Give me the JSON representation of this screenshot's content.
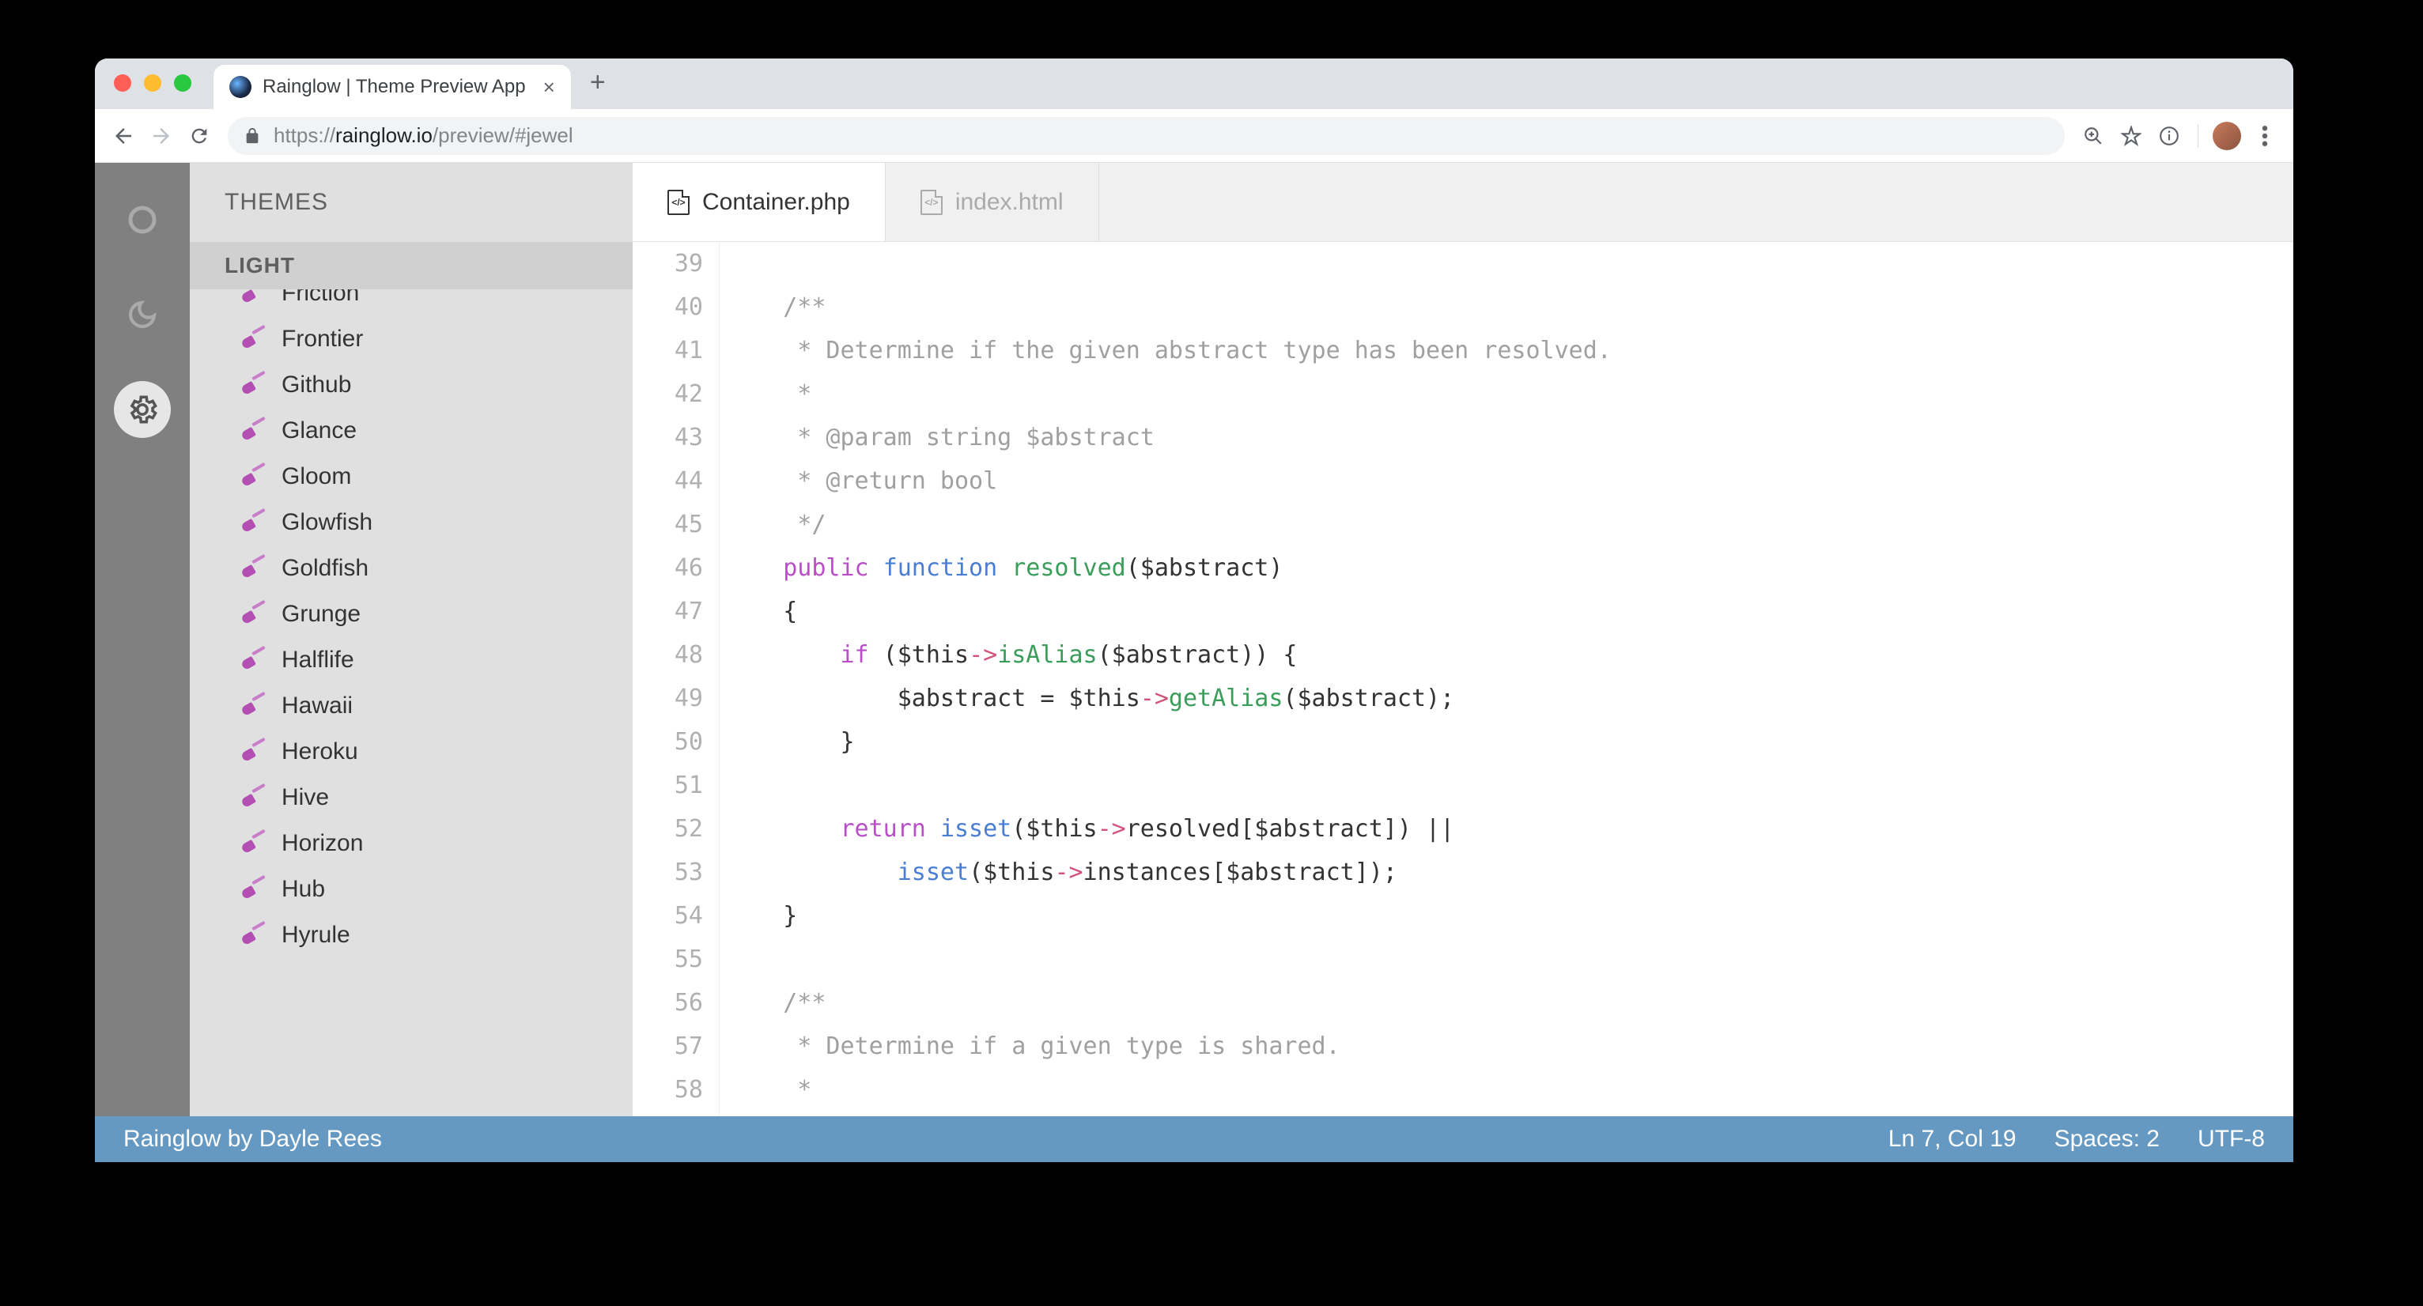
{
  "browser": {
    "tab_title": "Rainglow | Theme Preview App",
    "url_scheme": "https://",
    "url_host": "rainglow.io",
    "url_path": "/preview/#jewel"
  },
  "rail": {
    "mode_light": "light",
    "mode_dark": "dark",
    "mode_settings": "settings"
  },
  "sidebar": {
    "header": "THEMES",
    "section": "LIGHT",
    "items": [
      "Friction",
      "Frontier",
      "Github",
      "Glance",
      "Gloom",
      "Glowfish",
      "Goldfish",
      "Grunge",
      "Halflife",
      "Hawaii",
      "Heroku",
      "Hive",
      "Horizon",
      "Hub",
      "Hyrule"
    ]
  },
  "editor_tabs": [
    {
      "name": "Container.php",
      "active": true
    },
    {
      "name": "index.html",
      "active": false
    }
  ],
  "line_start": 39,
  "code": [
    {
      "n": 39,
      "t": []
    },
    {
      "n": 40,
      "t": [
        {
          "c": "c-comm",
          "s": "    /**"
        }
      ]
    },
    {
      "n": 41,
      "t": [
        {
          "c": "c-comm",
          "s": "     * Determine if the given abstract type has been resolved."
        }
      ]
    },
    {
      "n": 42,
      "t": [
        {
          "c": "c-comm",
          "s": "     *"
        }
      ]
    },
    {
      "n": 43,
      "t": [
        {
          "c": "c-comm",
          "s": "     * @param string $abstract"
        }
      ]
    },
    {
      "n": 44,
      "t": [
        {
          "c": "c-comm",
          "s": "     * @return bool"
        }
      ]
    },
    {
      "n": 45,
      "t": [
        {
          "c": "c-comm",
          "s": "     */"
        }
      ]
    },
    {
      "n": 46,
      "t": [
        {
          "c": "",
          "s": "    "
        },
        {
          "c": "c-kw",
          "s": "public"
        },
        {
          "c": "",
          "s": " "
        },
        {
          "c": "c-kw2",
          "s": "function"
        },
        {
          "c": "",
          "s": " "
        },
        {
          "c": "c-fn",
          "s": "resolved"
        },
        {
          "c": "",
          "s": "($abstract)"
        }
      ]
    },
    {
      "n": 47,
      "t": [
        {
          "c": "",
          "s": "    {"
        }
      ]
    },
    {
      "n": 48,
      "t": [
        {
          "c": "",
          "s": "        "
        },
        {
          "c": "c-kw",
          "s": "if"
        },
        {
          "c": "",
          "s": " ($this"
        },
        {
          "c": "c-op",
          "s": "->"
        },
        {
          "c": "c-fn",
          "s": "isAlias"
        },
        {
          "c": "",
          "s": "($abstract)) {"
        }
      ]
    },
    {
      "n": 49,
      "t": [
        {
          "c": "",
          "s": "            $abstract = $this"
        },
        {
          "c": "c-op",
          "s": "->"
        },
        {
          "c": "c-fn",
          "s": "getAlias"
        },
        {
          "c": "",
          "s": "($abstract);"
        }
      ]
    },
    {
      "n": 50,
      "t": [
        {
          "c": "",
          "s": "        }"
        }
      ]
    },
    {
      "n": 51,
      "t": []
    },
    {
      "n": 52,
      "t": [
        {
          "c": "",
          "s": "        "
        },
        {
          "c": "c-kw",
          "s": "return"
        },
        {
          "c": "",
          "s": " "
        },
        {
          "c": "c-new",
          "s": "isset"
        },
        {
          "c": "",
          "s": "($this"
        },
        {
          "c": "c-op",
          "s": "->"
        },
        {
          "c": "",
          "s": "resolved[$abstract]) ||"
        }
      ]
    },
    {
      "n": 53,
      "t": [
        {
          "c": "",
          "s": "            "
        },
        {
          "c": "c-new",
          "s": "isset"
        },
        {
          "c": "",
          "s": "($this"
        },
        {
          "c": "c-op",
          "s": "->"
        },
        {
          "c": "",
          "s": "instances[$abstract]);"
        }
      ]
    },
    {
      "n": 54,
      "t": [
        {
          "c": "",
          "s": "    }"
        }
      ]
    },
    {
      "n": 55,
      "t": []
    },
    {
      "n": 56,
      "t": [
        {
          "c": "c-comm",
          "s": "    /**"
        }
      ]
    },
    {
      "n": 57,
      "t": [
        {
          "c": "c-comm",
          "s": "     * Determine if a given type is shared."
        }
      ]
    },
    {
      "n": 58,
      "t": [
        {
          "c": "c-comm",
          "s": "     *"
        }
      ]
    }
  ],
  "status": {
    "credit": "Rainglow by Dayle Rees",
    "position": "Ln 7, Col 19",
    "spaces": "Spaces: 2",
    "encoding": "UTF-8"
  }
}
